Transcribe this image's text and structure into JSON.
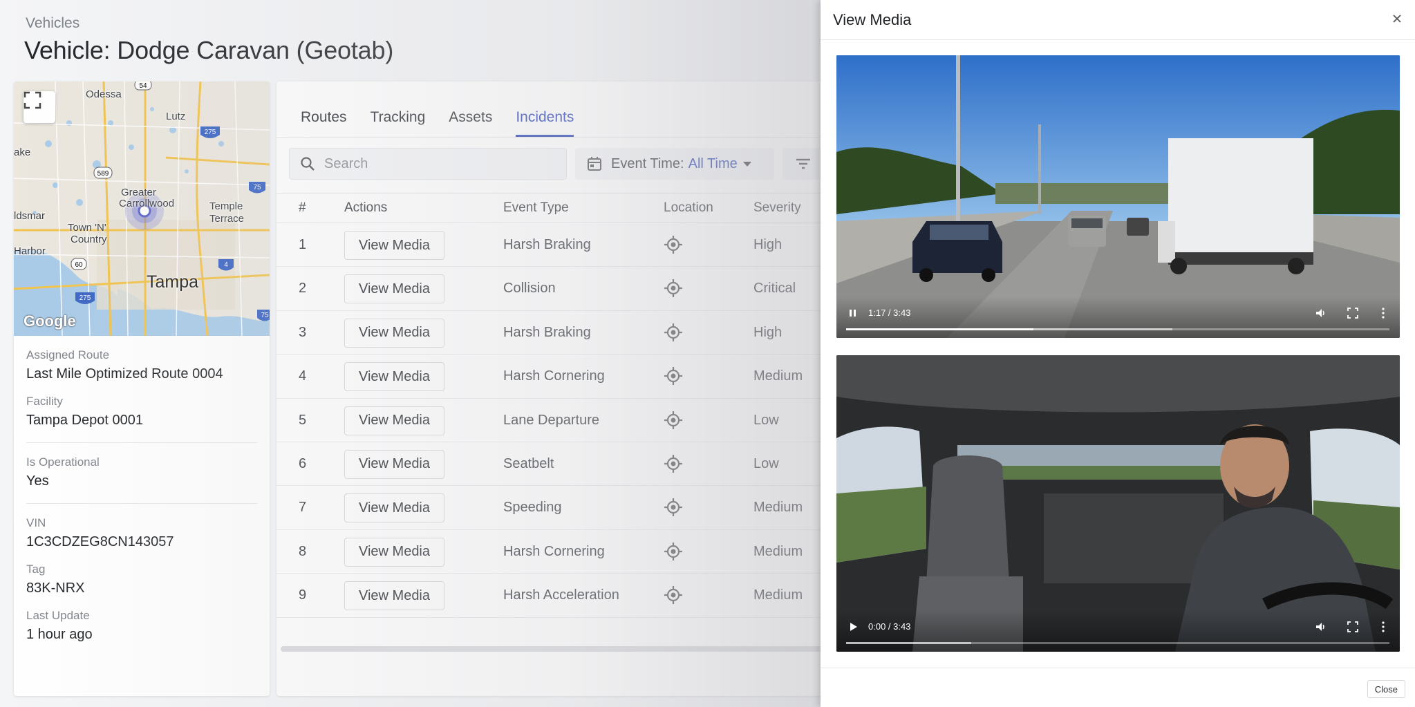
{
  "page": {
    "breadcrumb": "Vehicles",
    "title": "Vehicle: Dodge Caravan (Geotab)"
  },
  "map": {
    "labels": [
      "Odessa",
      "Lutz",
      "ake",
      "Greater",
      "Carrollwood",
      "Temple",
      "Terrace",
      "ldsmar",
      "Town 'N'",
      "Country",
      "Tampa",
      "Harbor"
    ],
    "highway_shields": [
      "54",
      "275",
      "589",
      "75",
      "60",
      "4",
      "275",
      "75"
    ],
    "logo": "Google",
    "expand_icon": "fullscreen-icon"
  },
  "vehicle_info": {
    "groups": [
      [
        {
          "label": "Assigned Route",
          "value": "Last Mile Optimized Route 0004"
        },
        {
          "label": "Facility",
          "value": "Tampa Depot 0001"
        }
      ],
      [
        {
          "label": "Is Operational",
          "value": "Yes"
        }
      ],
      [
        {
          "label": "VIN",
          "value": "1C3CDZEG8CN143057"
        },
        {
          "label": "Tag",
          "value": "83K-NRX"
        },
        {
          "label": "Last Update",
          "value": "1 hour ago"
        }
      ]
    ]
  },
  "tabs": [
    {
      "label": "Routes",
      "active": false
    },
    {
      "label": "Tracking",
      "active": false
    },
    {
      "label": "Assets",
      "active": false
    },
    {
      "label": "Incidents",
      "active": true
    }
  ],
  "toolbar": {
    "search_placeholder": "Search",
    "event_time_label": "Event Time:",
    "event_time_value": "All Time"
  },
  "incidents_table": {
    "columns": [
      "#",
      "Actions",
      "Event Type",
      "Location",
      "Severity"
    ],
    "action_label": "View Media",
    "rows": [
      {
        "num": "1",
        "event_type": "Harsh Braking",
        "severity": "High"
      },
      {
        "num": "2",
        "event_type": "Collision",
        "severity": "Critical"
      },
      {
        "num": "3",
        "event_type": "Harsh Braking",
        "severity": "High"
      },
      {
        "num": "4",
        "event_type": "Harsh Cornering",
        "severity": "Medium"
      },
      {
        "num": "5",
        "event_type": "Lane Departure",
        "severity": "Low"
      },
      {
        "num": "6",
        "event_type": "Seatbelt",
        "severity": "Low"
      },
      {
        "num": "7",
        "event_type": "Speeding",
        "severity": "Medium"
      },
      {
        "num": "8",
        "event_type": "Harsh Cornering",
        "severity": "Medium"
      },
      {
        "num": "9",
        "event_type": "Harsh Acceleration",
        "severity": "Medium"
      }
    ]
  },
  "drawer": {
    "title": "View Media",
    "close_button": "Close",
    "videos": [
      {
        "name": "road-facing-video",
        "time": "1:17 / 3:43",
        "state": "playing",
        "progress": 0.345,
        "buffered": 0.6
      },
      {
        "name": "driver-facing-video",
        "time": "0:00 / 3:43",
        "state": "paused",
        "progress": 0.0,
        "buffered": 0.23
      }
    ]
  },
  "colors": {
    "accent": "#2f48b7",
    "map_water": "#a9cbe8",
    "map_land": "#e8e4da"
  }
}
